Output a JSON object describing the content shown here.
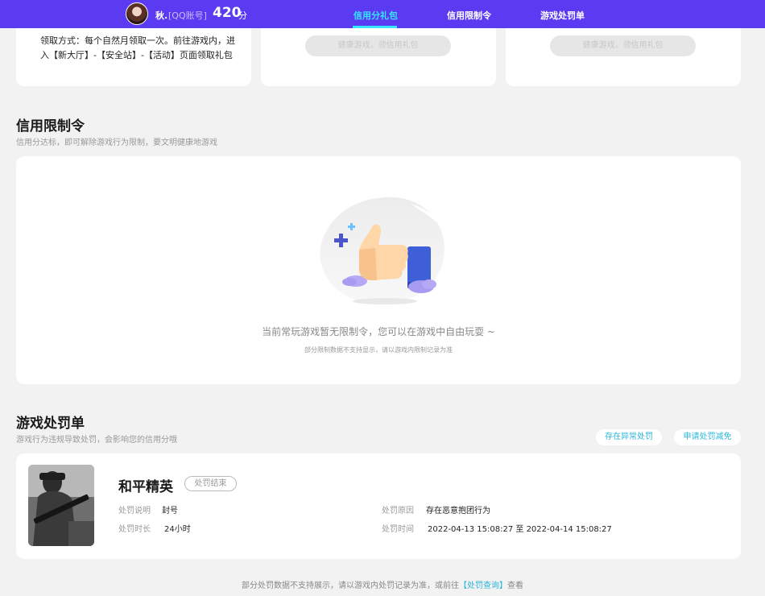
{
  "header": {
    "nickname": "秋.",
    "account_type": "[QQ账号]",
    "score": "420",
    "score_unit": "分",
    "tabs": [
      {
        "label": "信用分礼包",
        "active": true
      },
      {
        "label": "信用限制令",
        "active": false
      },
      {
        "label": "游戏处罚单",
        "active": false
      }
    ],
    "bg_color": "#5b3bf2",
    "active_color": "#35e6ff"
  },
  "gift_cards": {
    "claim_text": "领取方式：每个自然月领取一次。前往游戏内，进入【新大厅】-【安全站】-【活动】页面领取礼包",
    "button_label": "健康游戏，领信用礼包"
  },
  "restriction": {
    "title": "信用限制令",
    "subtitle": "信用分达标，即可解除游戏行为限制，要文明健康地游戏",
    "empty_text": "当前常玩游戏暂无限制令，您可以在游戏中自由玩耍 ~",
    "empty_note": "部分限制数据不支持显示，请以游戏内限制记录为准",
    "illustration_icon": "thumbs-up-icon"
  },
  "penalty": {
    "title": "游戏处罚单",
    "subtitle": "游戏行为违规导致处罚，会影响您的信用分哦",
    "action_abnormal": "存在异常处罚",
    "action_appeal": "申请处罚减免",
    "record": {
      "game_name": "和平精英",
      "status": "处罚结束",
      "desc_label": "处罚说明",
      "desc_value": "封号",
      "duration_label": "处罚时长",
      "duration_value": "24小时",
      "reason_label": "处罚原因",
      "reason_value": "存在恶意抱团行为",
      "time_label": "处罚时间",
      "time_value": "2022-04-13 15:08:27 至 2022-04-14 15:08:27"
    }
  },
  "footer": {
    "text": "部分处罚数据不支持展示，请以游戏内处罚记录为准，或前往",
    "link": "【处罚查询】",
    "suffix": "查看"
  }
}
